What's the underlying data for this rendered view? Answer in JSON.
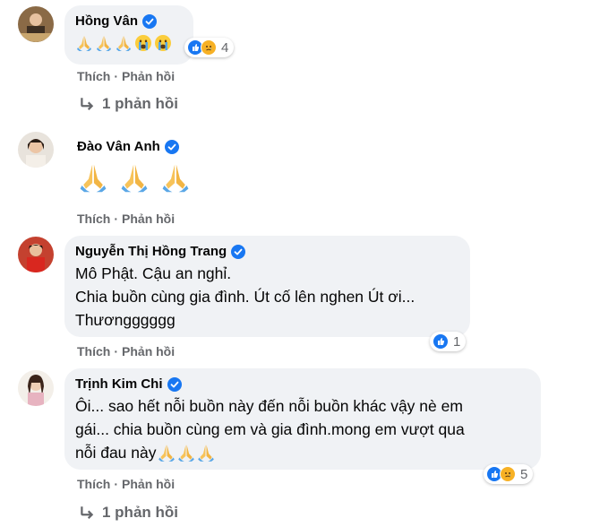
{
  "actions": {
    "like": "Thích",
    "dot": "·",
    "reply": "Phản hồi"
  },
  "comments": [
    {
      "author": "Hồng Vân",
      "text_lines": [],
      "emoji": [
        "praying-hands",
        "praying-hands",
        "praying-hands",
        "crying-face",
        "crying-face"
      ],
      "reactions": {
        "icons": [
          "like",
          "sad"
        ],
        "count": "4"
      },
      "replies_label": "1 phản hồi"
    },
    {
      "author": "Đào Vân Anh",
      "text_lines": [],
      "emoji": [
        "praying-hands",
        "praying-hands",
        "praying-hands"
      ],
      "reactions": null,
      "replies_label": ""
    },
    {
      "author": "Nguyễn Thị Hồng Trang",
      "text_lines": [
        "Mô Phật. Cậu an nghỉ.",
        "Chia buồn cùng gia đình. Út cố lên nghen Út ơi...",
        "Thươngggggg"
      ],
      "emoji": [],
      "reactions": {
        "icons": [
          "like"
        ],
        "count": "1"
      },
      "replies_label": ""
    },
    {
      "author": "Trịnh Kim Chi",
      "text_lines": [
        "Ôi... sao hết nỗi buồn này đến nỗi buồn khác vậy nè em",
        "gái... chia buồn cùng em và gia đình.mong em vượt qua",
        "nỗi đau này"
      ],
      "emoji": [
        "praying-hands",
        "praying-hands",
        "praying-hands"
      ],
      "reactions": {
        "icons": [
          "like",
          "sad"
        ],
        "count": "5"
      },
      "replies_label": "1 phản hồi"
    }
  ],
  "colors": {
    "bubble": "#f0f2f5",
    "verified": "#1877f2",
    "like": "#1877f2",
    "sad": "#f7b125",
    "muted": "#65676b"
  }
}
